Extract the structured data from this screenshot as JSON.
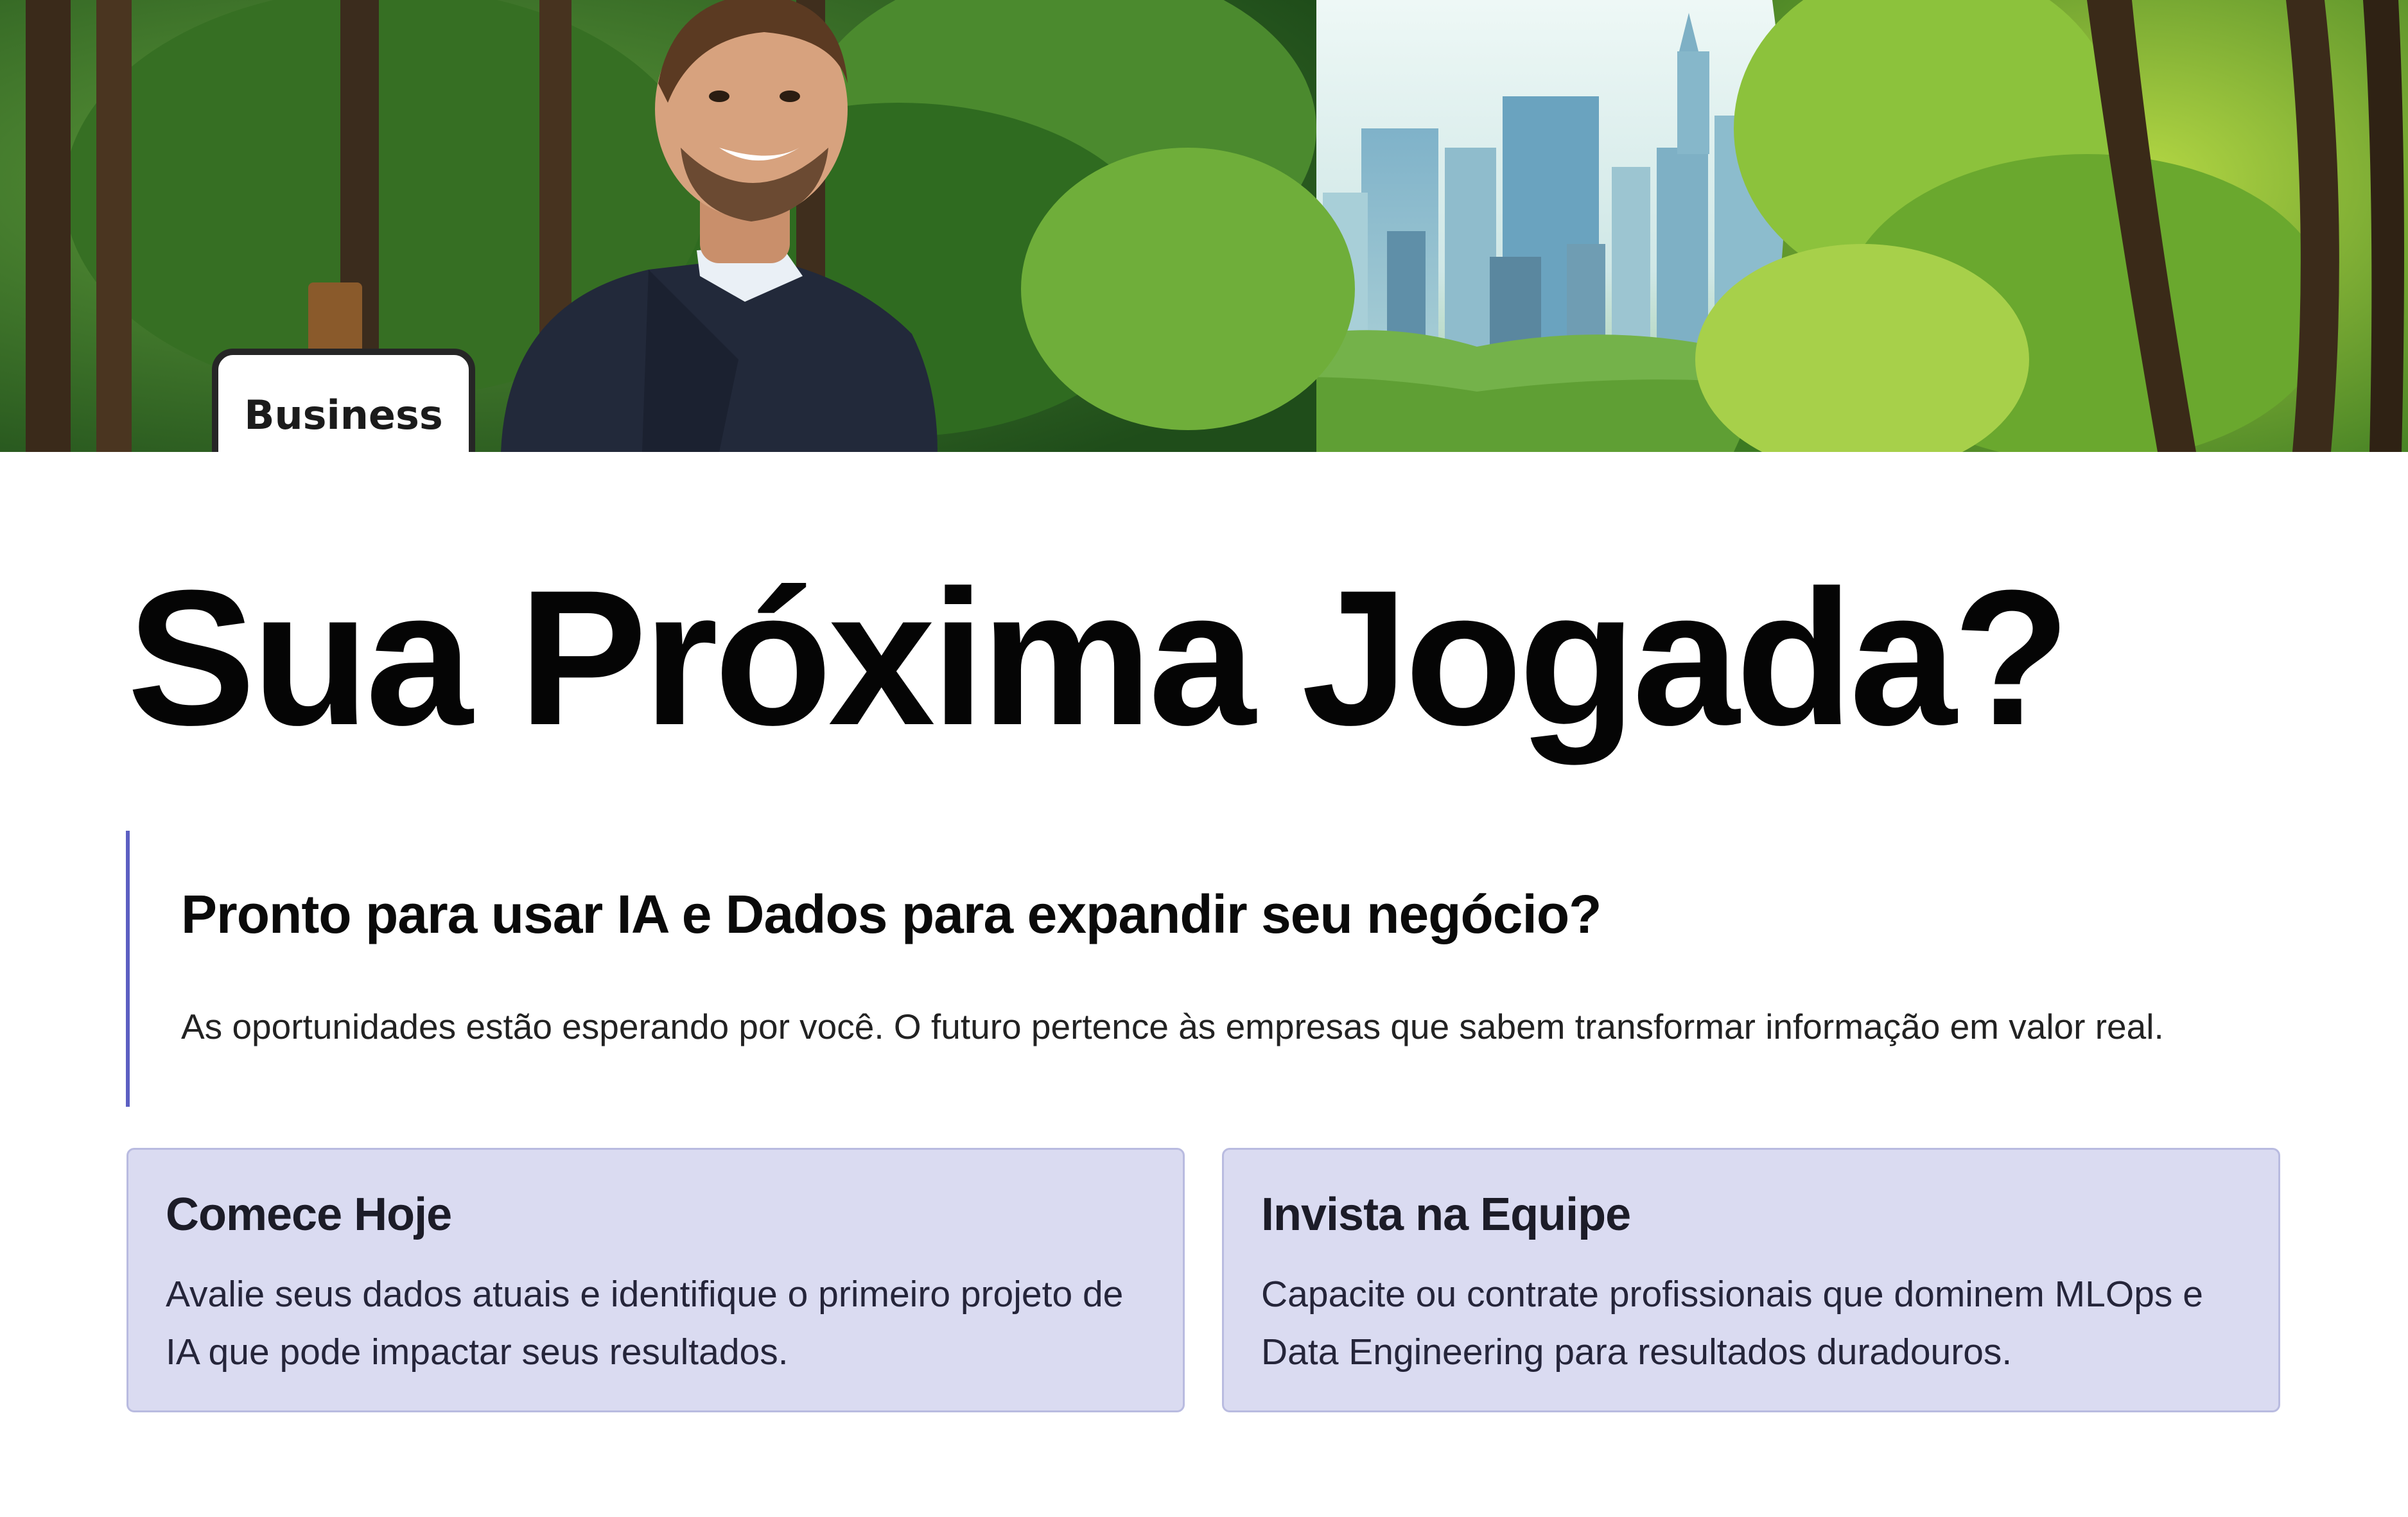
{
  "hero": {
    "image_alt": "Smiling businessman in a dark suit in a lush forest, city skyline in the distance",
    "sign_text": "Business"
  },
  "main": {
    "title": "Sua Próxima Jogada?",
    "callout": {
      "heading": "Pronto para usar IA e Dados para expandir seu negócio?",
      "body": "As oportunidades estão esperando por você. O futuro pertence às empresas que sabem transformar informação em valor real.",
      "accent_color": "#5c5fc2"
    },
    "cards": [
      {
        "title": "Comece Hoje",
        "body": "Avalie seus dados atuais e identifique o primeiro projeto de IA que pode impactar seus resultados."
      },
      {
        "title": "Invista na Equipe",
        "body": "Capacite ou contrate profissionais que dominem MLOps e Data Engineering para resultados duradouros."
      }
    ],
    "card_color": "#dadbf1"
  }
}
